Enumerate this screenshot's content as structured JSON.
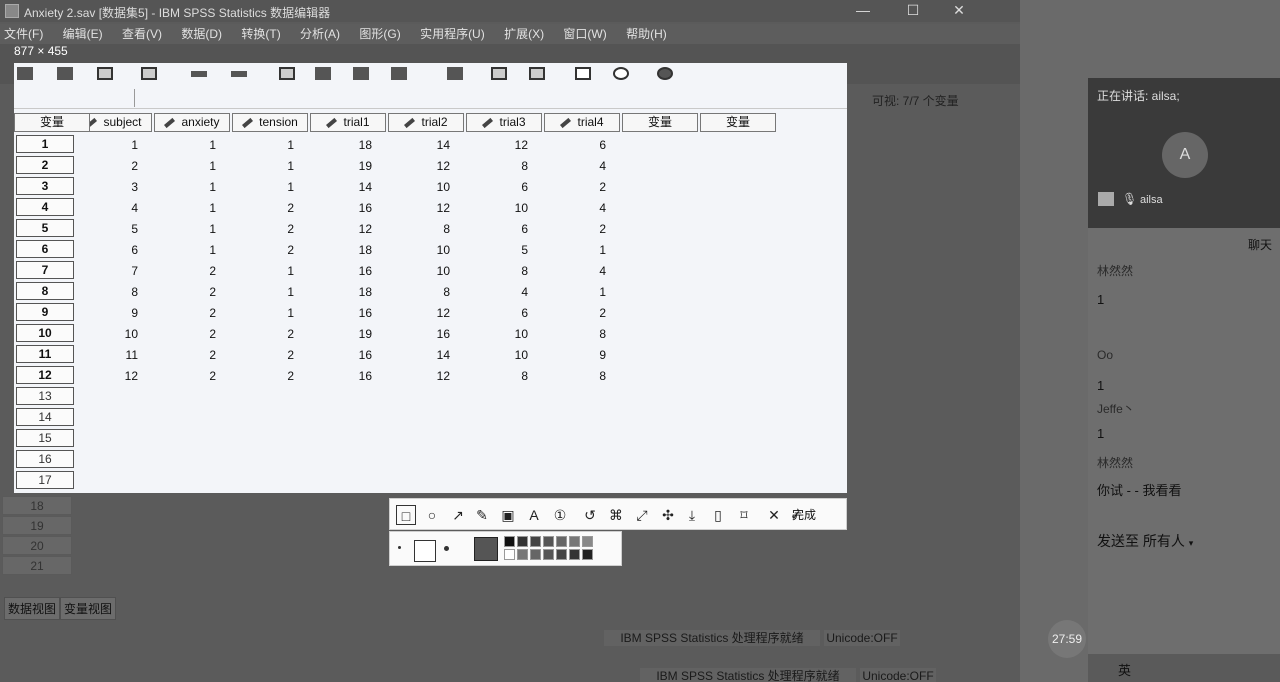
{
  "window": {
    "title": "Anxiety 2.sav [数据集5] - IBM SPSS Statistics 数据编辑器"
  },
  "menu": [
    "文件(F)",
    "编辑(E)",
    "查看(V)",
    "数据(D)",
    "转换(T)",
    "分析(A)",
    "图形(G)",
    "实用程序(U)",
    "扩展(X)",
    "窗口(W)",
    "帮助(H)"
  ],
  "capture_size_label": "877 × 455",
  "visible_label": "可视: 7/7 个变量",
  "columns": [
    "subject",
    "anxiety",
    "tension",
    "trial1",
    "trial2",
    "trial3",
    "trial4"
  ],
  "empty_columns": [
    "变量",
    "变量",
    "变量",
    "变量",
    "变量"
  ],
  "rows": [
    [
      1,
      1,
      1,
      18,
      14,
      12,
      6
    ],
    [
      2,
      1,
      1,
      19,
      12,
      8,
      4
    ],
    [
      3,
      1,
      1,
      14,
      10,
      6,
      2
    ],
    [
      4,
      1,
      2,
      16,
      12,
      10,
      4
    ],
    [
      5,
      1,
      2,
      12,
      8,
      6,
      2
    ],
    [
      6,
      1,
      2,
      18,
      10,
      5,
      1
    ],
    [
      7,
      2,
      1,
      16,
      10,
      8,
      4
    ],
    [
      8,
      2,
      1,
      18,
      8,
      4,
      1
    ],
    [
      9,
      2,
      1,
      16,
      12,
      6,
      2
    ],
    [
      10,
      2,
      2,
      19,
      16,
      10,
      8
    ],
    [
      11,
      2,
      2,
      16,
      14,
      10,
      9
    ],
    [
      12,
      2,
      2,
      16,
      12,
      8,
      8
    ]
  ],
  "extra_rows": [
    "13",
    "14",
    "15",
    "16",
    "17"
  ],
  "dim_rows": [
    "18",
    "19",
    "20",
    "21"
  ],
  "view_tabs": {
    "data": "数据视图",
    "variable": "变量视图"
  },
  "status": {
    "processor": "IBM SPSS Statistics 处理程序就绪",
    "unicode": "Unicode:OFF"
  },
  "screenshot_tool": {
    "done_label": "完成"
  },
  "meeting": {
    "speaking": "正在讲话: ailsa;",
    "avatar_letter": "A",
    "participant": "ailsa"
  },
  "chat": {
    "title": "聊天",
    "messages": [
      {
        "sender": "林然然",
        "text": "1"
      },
      {
        "sender": "Oo",
        "text": "1"
      },
      {
        "sender": "Jeffe丶",
        "text": "1"
      },
      {
        "sender": "林然然",
        "text": "你试 - - 我看看"
      }
    ],
    "send_to_label": "发送至",
    "send_to_target": "所有人"
  },
  "clock": "27:59",
  "taskbar": {
    "ime": "英"
  }
}
